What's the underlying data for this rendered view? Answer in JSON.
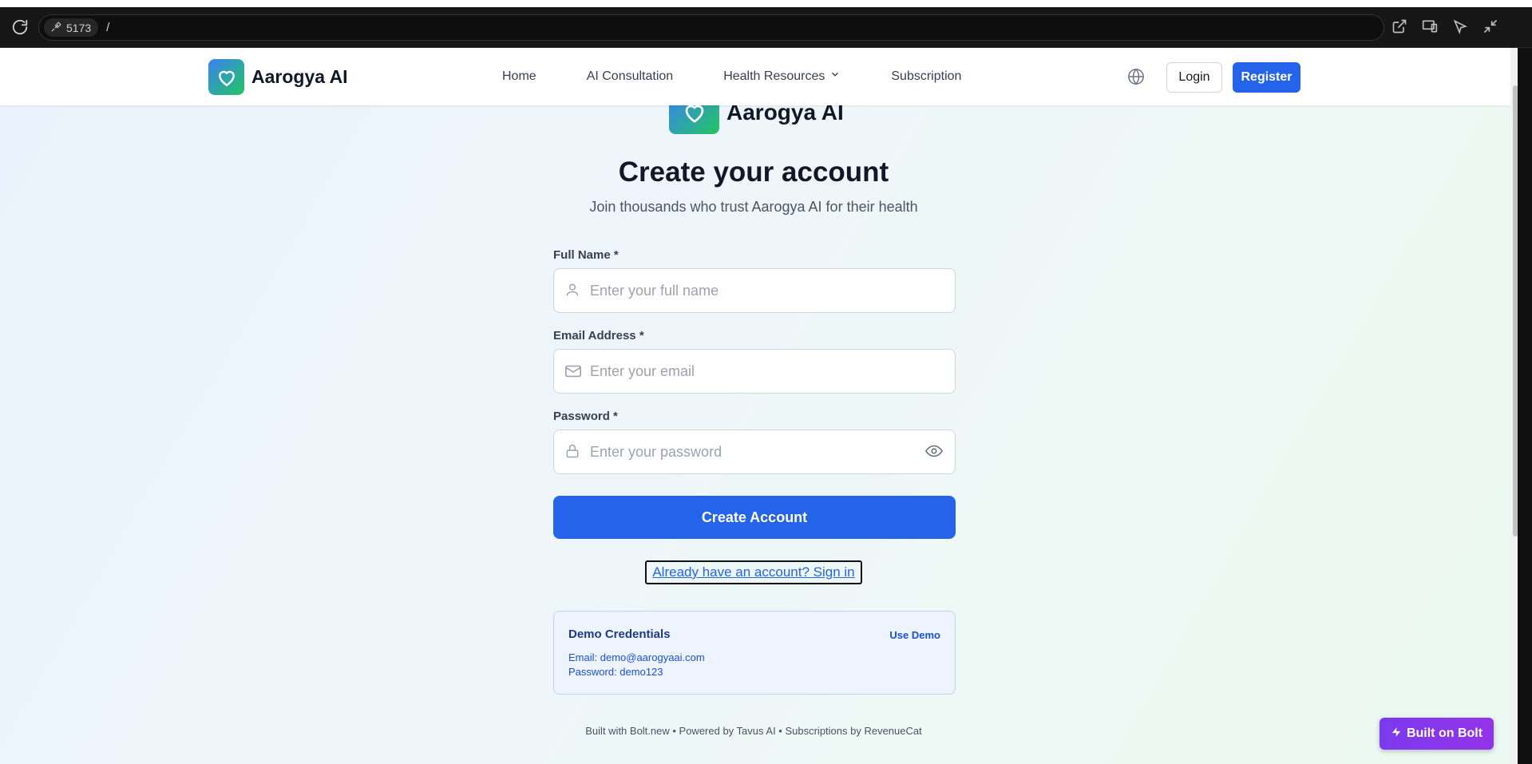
{
  "browser": {
    "port": "5173",
    "path": "/",
    "icons": [
      "external-link-icon",
      "device-toggle-icon",
      "cursor-inspect-icon",
      "collapse-icon"
    ]
  },
  "nav": {
    "brand": "Aarogya AI",
    "links": [
      "Home",
      "AI Consultation",
      "Health Resources",
      "Subscription"
    ],
    "login": "Login",
    "register": "Register"
  },
  "page": {
    "brand": "Aarogya AI",
    "title": "Create your account",
    "subtitle": "Join thousands who trust Aarogya AI for their health"
  },
  "form": {
    "full_name_label": "Full Name *",
    "full_name_placeholder": "Enter your full name",
    "email_label": "Email Address *",
    "email_placeholder": "Enter your email",
    "password_label": "Password *",
    "password_placeholder": "Enter your password",
    "submit": "Create Account",
    "signin_link": "Already have an account? Sign in"
  },
  "demo": {
    "title": "Demo Credentials",
    "use": "Use Demo",
    "email": "Email: demo@aarogyaai.com",
    "password": "Password: demo123"
  },
  "footer": "Built with Bolt.new • Powered by Tavus AI • Subscriptions by RevenueCat",
  "bolt_badge": "Built on Bolt",
  "colors": {
    "primary": "#2563eb",
    "brand_gradient_start": "#3b82f6",
    "brand_gradient_end": "#22c55e",
    "bolt": "#7c3aed"
  }
}
